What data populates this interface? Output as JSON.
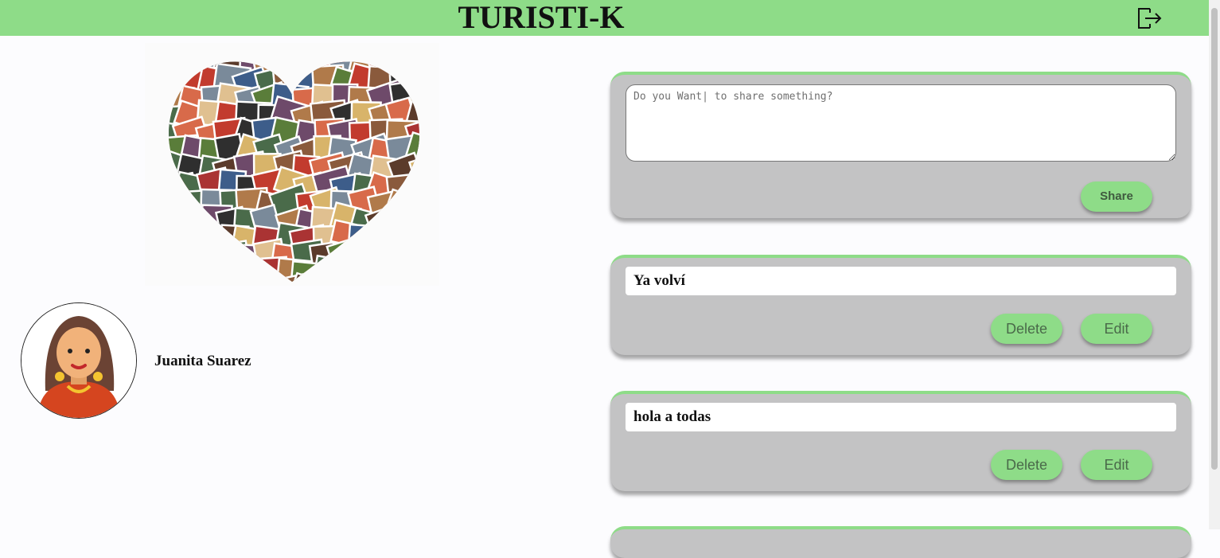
{
  "header": {
    "title": "TURISTI-K",
    "logout_icon": "logout-icon",
    "background_color": "#8edc88"
  },
  "profile": {
    "cover_image": "heart-photo-collage",
    "avatar": "woman-avatar",
    "name": "Juanita Suarez"
  },
  "composer": {
    "placeholder": "Do you Want| to share something?",
    "share_label": "Share"
  },
  "posts": [
    {
      "text": "Ya volví",
      "delete_label": "Delete",
      "edit_label": "Edit"
    },
    {
      "text": "hola a todas",
      "delete_label": "Delete",
      "edit_label": "Edit"
    }
  ],
  "colors": {
    "accent": "#8edc88",
    "card": "#c3c3c4"
  }
}
